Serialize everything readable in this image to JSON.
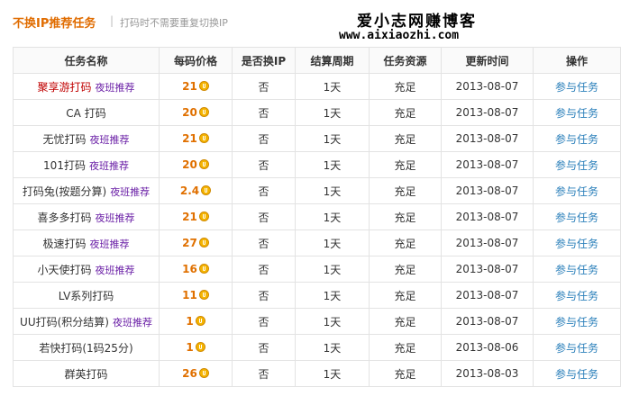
{
  "header": {
    "title": "不换IP推荐任务",
    "separator": "|",
    "subtitle": "打码时不需要重复切换IP",
    "brand_name": "爱小志网赚博客",
    "brand_url": "www.aixiaozhi.com"
  },
  "table": {
    "columns": [
      "任务名称",
      "每码价格",
      "是否换IP",
      "结算周期",
      "任务资源",
      "更新时间",
      "操作"
    ],
    "rows": [
      {
        "name": "聚享游打码",
        "name_red": true,
        "badge": "夜班推荐",
        "price": "21",
        "change_ip": "否",
        "cycle": "1天",
        "resource": "充足",
        "updated": "2013-08-07",
        "updated_new": true,
        "action": "参与任务"
      },
      {
        "name": "CA 打码",
        "name_red": false,
        "badge": "",
        "price": "20",
        "change_ip": "否",
        "cycle": "1天",
        "resource": "充足",
        "updated": "2013-08-07",
        "updated_new": true,
        "action": "参与任务"
      },
      {
        "name": "无忧打码",
        "name_red": false,
        "badge": "夜班推荐",
        "price": "21",
        "change_ip": "否",
        "cycle": "1天",
        "resource": "充足",
        "updated": "2013-08-07",
        "updated_new": true,
        "action": "参与任务"
      },
      {
        "name": "101打码",
        "name_red": false,
        "badge": "夜班推荐",
        "price": "20",
        "change_ip": "否",
        "cycle": "1天",
        "resource": "充足",
        "updated": "2013-08-07",
        "updated_new": true,
        "action": "参与任务"
      },
      {
        "name": "打码兔(按题分算)",
        "name_red": false,
        "badge": "夜班推荐",
        "price": "2.4",
        "change_ip": "否",
        "cycle": "1天",
        "resource": "充足",
        "updated": "2013-08-07",
        "updated_new": true,
        "action": "参与任务"
      },
      {
        "name": "喜多多打码",
        "name_red": false,
        "badge": "夜班推荐",
        "price": "21",
        "change_ip": "否",
        "cycle": "1天",
        "resource": "充足",
        "updated": "2013-08-07",
        "updated_new": true,
        "action": "参与任务"
      },
      {
        "name": "极速打码",
        "name_red": false,
        "badge": "夜班推荐",
        "price": "27",
        "change_ip": "否",
        "cycle": "1天",
        "resource": "充足",
        "updated": "2013-08-07",
        "updated_new": true,
        "action": "参与任务"
      },
      {
        "name": "小天使打码",
        "name_red": false,
        "badge": "夜班推荐",
        "price": "16",
        "change_ip": "否",
        "cycle": "1天",
        "resource": "充足",
        "updated": "2013-08-07",
        "updated_new": true,
        "action": "参与任务"
      },
      {
        "name": "LV系列打码",
        "name_red": false,
        "badge": "",
        "price": "11",
        "change_ip": "否",
        "cycle": "1天",
        "resource": "充足",
        "updated": "2013-08-07",
        "updated_new": true,
        "action": "参与任务"
      },
      {
        "name": "UU打码(积分结算)",
        "name_red": false,
        "badge": "夜班推荐",
        "price": "1",
        "change_ip": "否",
        "cycle": "1天",
        "resource": "充足",
        "updated": "2013-08-07",
        "updated_new": true,
        "action": "参与任务"
      },
      {
        "name": "若快打码(1码25分)",
        "name_red": false,
        "badge": "",
        "price": "1",
        "change_ip": "否",
        "cycle": "1天",
        "resource": "充足",
        "updated": "2013-08-06",
        "updated_new": false,
        "action": "参与任务"
      },
      {
        "name": "群英打码",
        "name_red": false,
        "badge": "",
        "price": "26",
        "change_ip": "否",
        "cycle": "1天",
        "resource": "充足",
        "updated": "2013-08-03",
        "updated_new": false,
        "action": "参与任务"
      }
    ]
  },
  "colors": {
    "title": "#e06c00",
    "name_highlight": "#c00000",
    "badge": "#6a1fa6",
    "price": "#e07000",
    "coin": "#f5b400",
    "date_new": "#d00000",
    "date_old": "#999999",
    "action_link": "#2a7fba"
  },
  "icons": {
    "price_coin": "coin-icon"
  }
}
